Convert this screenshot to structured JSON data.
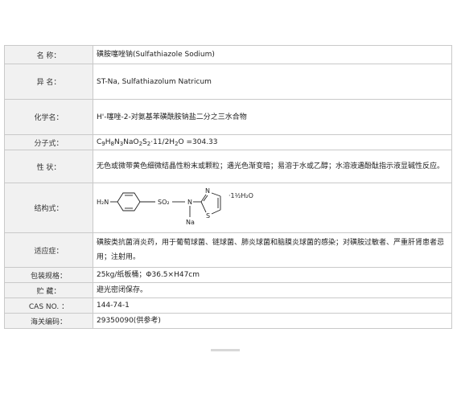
{
  "rows": {
    "name": {
      "label": "名 称：",
      "value": "磺胺噻唑钠(Sulfathiazole Sodium)"
    },
    "alias": {
      "label": "异 名：",
      "value": "ST-Na, Sulfathiazolum Natricum"
    },
    "chemical": {
      "label": "化学名：",
      "value": "H'-噻唑-2-对氨基苯磺酰胺钠盐二分之三水合物"
    },
    "formula": {
      "label": "分子式：",
      "parts": [
        "C",
        "9",
        "H",
        "8",
        "N",
        "3",
        "NaO",
        "2",
        "S",
        "2",
        "·11/2H",
        "2",
        "O =304.33"
      ]
    },
    "properties": {
      "label": "性 状：",
      "value": "无色或微带黄色细微结晶性粉末或颗粒；遇光色渐变暗；易溶于水或乙醇；水溶液遇酚酞指示液显碱性反应。"
    },
    "structure": {
      "label": "结构式：",
      "h2n": "H₂N",
      "so2": "SO₂",
      "n": "N",
      "ring_n": "N",
      "ring_s": "S",
      "na": "Na",
      "hydrate": "·1½H₂O"
    },
    "indication": {
      "label": "适应症：",
      "value": "磺胺类抗菌消炎药，用于葡萄球菌、链球菌、肺炎球菌和脑膜炎球菌的感染；对磺胺过敏者、严重肝肾患者忌用；注射用。"
    },
    "packing": {
      "label": "包装规格：",
      "value": "25kg/纸板桶；Φ36.5×H47cm"
    },
    "storage": {
      "label": "贮 藏：",
      "value": "避光密闭保存。"
    },
    "cas": {
      "label": "CAS NO. ：",
      "value": "144-74-1"
    },
    "hs": {
      "label": "海关编码：",
      "value": "29350090(供参考)"
    }
  }
}
